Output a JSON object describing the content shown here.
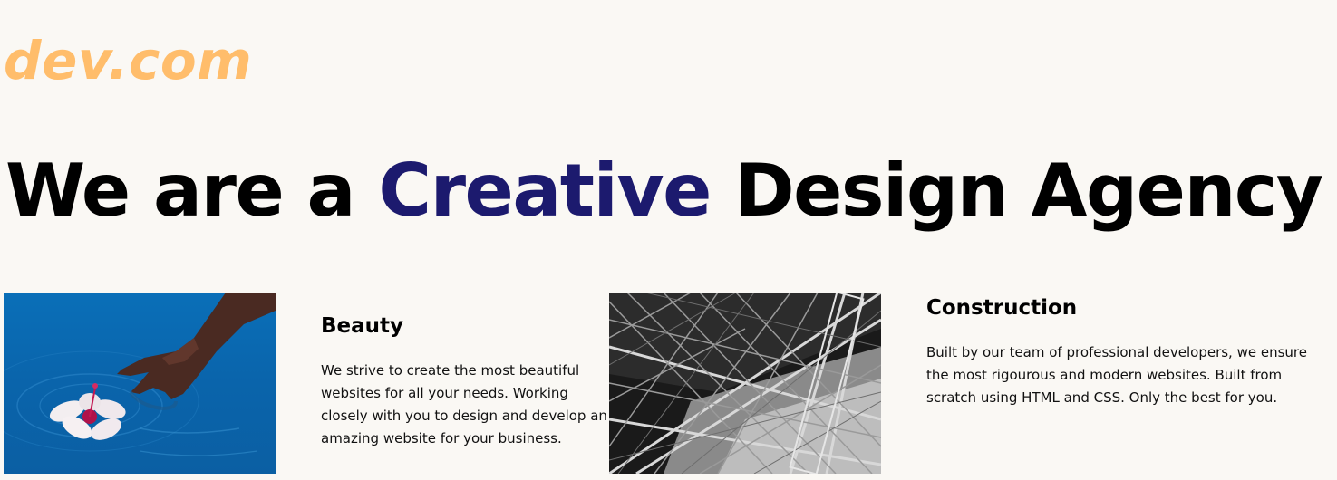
{
  "header": {
    "logo_text": "dev.com"
  },
  "hero": {
    "title_before": "We are a ",
    "title_accent": "Creative",
    "title_after": " Design Agency"
  },
  "cards": [
    {
      "image": "hand-flower-water-photo",
      "title": "Beauty",
      "body": "We strive to create the most beautiful websites for all your needs. Working closely with you to design and develop an amazing website for your business."
    },
    {
      "image": "steel-structure-photo",
      "title": "Construction",
      "body": "Built by our team of professional developers, we ensure the most rigourous and modern websites. Built from scratch using HTML and CSS. Only the best for you."
    }
  ],
  "colors": {
    "background": "#faf8f4",
    "logo": "#ffbd6b",
    "accent": "#1c1a6e",
    "text": "#000000"
  }
}
